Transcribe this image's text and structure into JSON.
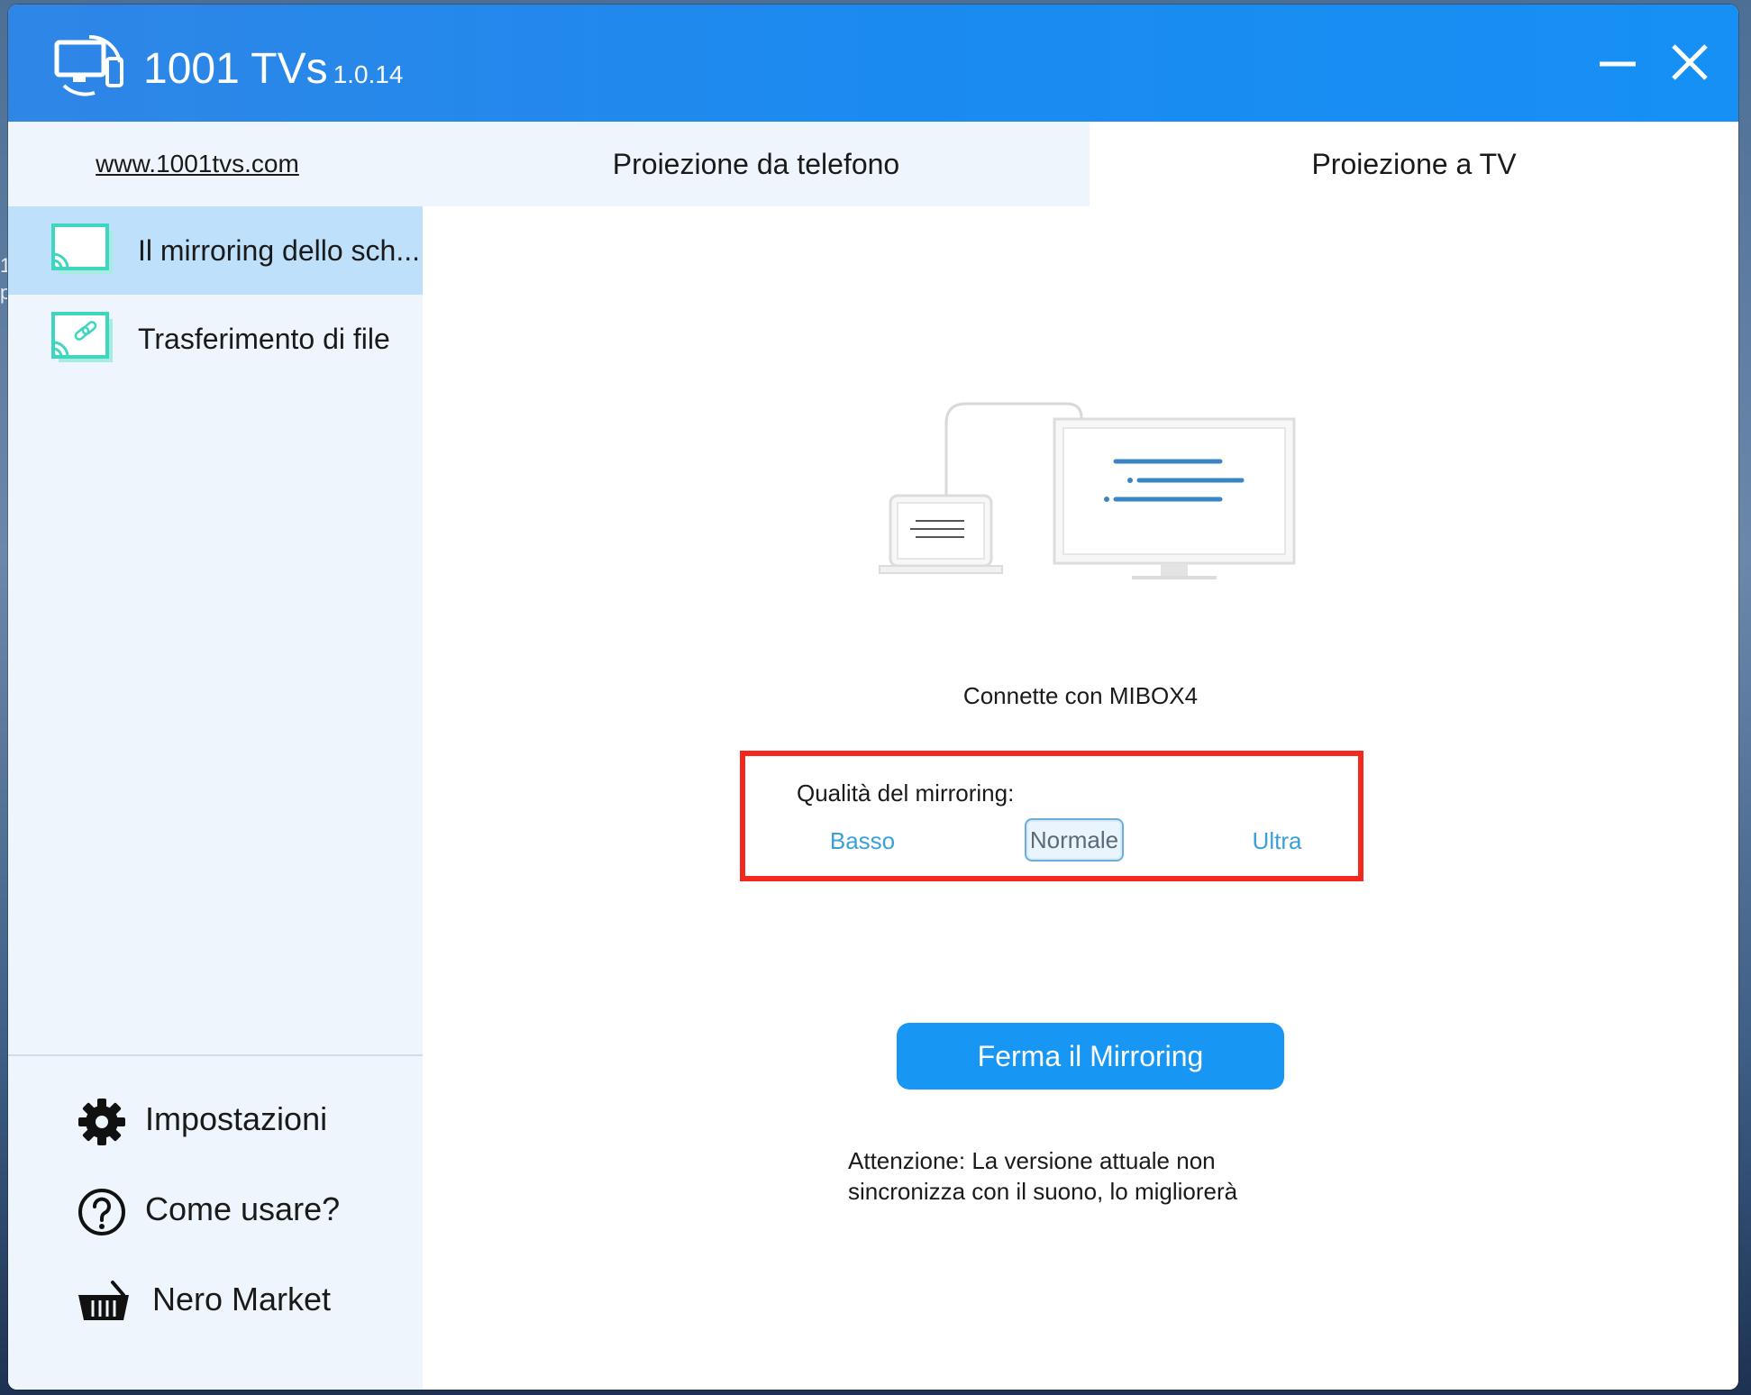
{
  "app": {
    "title": "1001 TVs",
    "version": "1.0.14",
    "icon": "tv-phone-logo-icon"
  },
  "window_controls": {
    "minimize_icon": "minimize-icon",
    "close_icon": "close-icon"
  },
  "sidebar": {
    "website": "www.1001tvs.com",
    "items": [
      {
        "label": "Il mirroring dello sch...",
        "icon": "screen-cast-icon",
        "active": true
      },
      {
        "label": "Trasferimento di file",
        "icon": "file-transfer-cast-icon",
        "active": false
      }
    ],
    "bottom_items": [
      {
        "label": "Impostazioni",
        "icon": "gear-icon"
      },
      {
        "label": "Come usare?",
        "icon": "help-circle-icon"
      },
      {
        "label": "Nero Market",
        "icon": "basket-icon"
      }
    ]
  },
  "tabs": [
    {
      "label": "Proiezione da telefono",
      "active": false
    },
    {
      "label": "Proiezione a TV",
      "active": true
    }
  ],
  "main": {
    "illustration_icon": "laptop-to-monitor-icon",
    "connection_text": "Connette con MIBOX4",
    "quality": {
      "label": "Qualità del mirroring:",
      "options": [
        "Basso",
        "Normale",
        "Ultra"
      ],
      "selected": "Normale"
    },
    "stop_button": "Ferma il Mirroring",
    "warning_line1": "Attenzione: La versione attuale non",
    "warning_line2": "sincronizza con il suono, lo migliorerà"
  },
  "colors": {
    "titlebar": "#1b8af0",
    "accent": "#1796f3",
    "highlight_border": "#f2291c",
    "sidebar_bg": "#eef5fc",
    "active_item_bg": "#bfe0fa",
    "cast_icon": "#3fd6c0"
  }
}
